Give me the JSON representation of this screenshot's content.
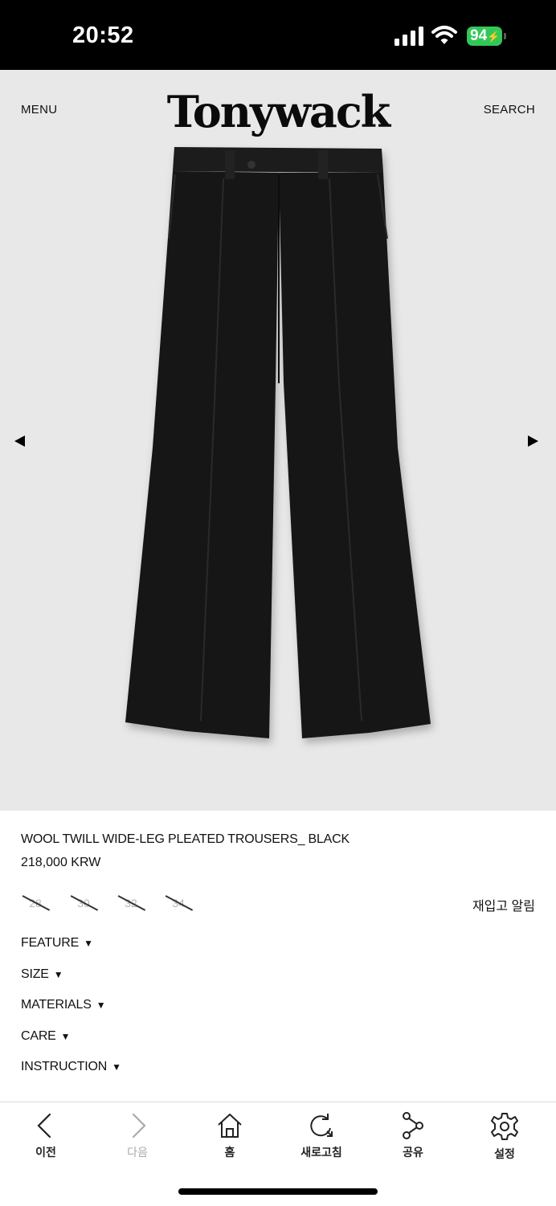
{
  "status": {
    "time": "20:52",
    "battery": "94"
  },
  "header": {
    "menu": "MENU",
    "brand": "Tonywack",
    "search": "SEARCH"
  },
  "gallery": {
    "image": "black wide-leg pleated trousers",
    "prev_icon": "triangle-left",
    "next_icon": "triangle-right"
  },
  "product": {
    "name": "WOOL TWILL WIDE-LEG PLEATED TROUSERS_ BLACK",
    "price": "218,000 KRW",
    "sizes": [
      "28",
      "30",
      "32",
      "34"
    ],
    "restock": "재입고 알림"
  },
  "accordion": [
    {
      "label": "FEATURE",
      "caret": "▼"
    },
    {
      "label": "SIZE",
      "caret": "▼"
    },
    {
      "label": "MATERIALS",
      "caret": "▼"
    },
    {
      "label": "CARE",
      "caret": "▼"
    },
    {
      "label": "INSTRUCTION",
      "caret": "▼"
    }
  ],
  "toolbar": {
    "back": "이전",
    "forward": "다음",
    "home": "홈",
    "refresh": "새로고침",
    "share": "공유",
    "settings": "설정"
  },
  "colors": {
    "hero_bg": "#e8e8e8",
    "battery": "#33c759"
  }
}
